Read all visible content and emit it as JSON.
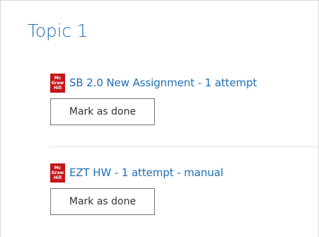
{
  "section": {
    "title": "Topic 1"
  },
  "activities": [
    {
      "logo_lines": [
        "Mc",
        "Graw",
        "Hill"
      ],
      "title": "SB 2.0 New Assignment - 1 attempt",
      "button_label": "Mark as done"
    },
    {
      "logo_lines": [
        "Mc",
        "Graw",
        "Hill"
      ],
      "title": "EZT HW - 1 attempt - manual",
      "button_label": "Mark as done"
    }
  ],
  "colors": {
    "link": "#1f6fb3",
    "logo_background": "#c4161c",
    "button_border": "#757575"
  },
  "icons": {
    "activity_logo": "mcgraw-hill-logo-icon"
  }
}
